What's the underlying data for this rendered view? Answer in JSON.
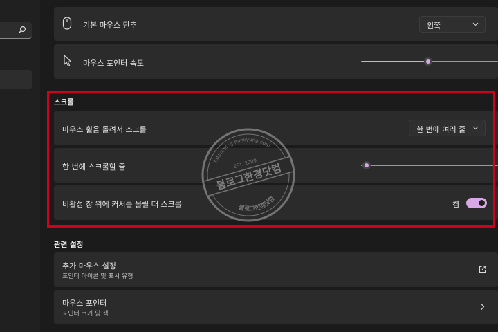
{
  "colors": {
    "accent": "#d8a8e6",
    "highlight_border": "#d3001b",
    "card_bg": "#2b2b2b",
    "page_bg": "#1b1b1b"
  },
  "sidebar": {
    "search_icon": "search-icon"
  },
  "mouse": {
    "primary_button": {
      "label": "기본 마우스 단추",
      "icon": "mouse-icon",
      "value": "왼쪽"
    },
    "pointer_speed": {
      "label": "마우스 포인터 속도",
      "icon": "cursor-arrow-icon",
      "value_fraction": 0.49
    }
  },
  "scroll": {
    "title": "스크롤",
    "wheel_scroll": {
      "label": "마우스 휠을 돌려서 스크롤",
      "value": "한 번에 여러 줄"
    },
    "lines_per_scroll": {
      "label": "한 번에 스크롤할 줄",
      "value_fraction": 0.04
    },
    "inactive_scroll": {
      "label": "비활성 창 위에 커서를 올릴 때 스크롤",
      "state_label": "켬",
      "on": true
    }
  },
  "related": {
    "title": "관련 설정",
    "items": [
      {
        "title": "추가 마우스 설정",
        "subtitle": "포인터 아이콘 및 표시 유형",
        "icon": "external-link-icon"
      },
      {
        "title": "마우스 포인터",
        "subtitle": "포인터 크기 및 색",
        "icon": "chevron-right-icon"
      }
    ]
  },
  "watermark": {
    "main": "블로그한경닷컴",
    "url": "http://blog.hankyung.com",
    "est": "EST. 2009",
    "reverse": "블로그한경닷컴"
  }
}
